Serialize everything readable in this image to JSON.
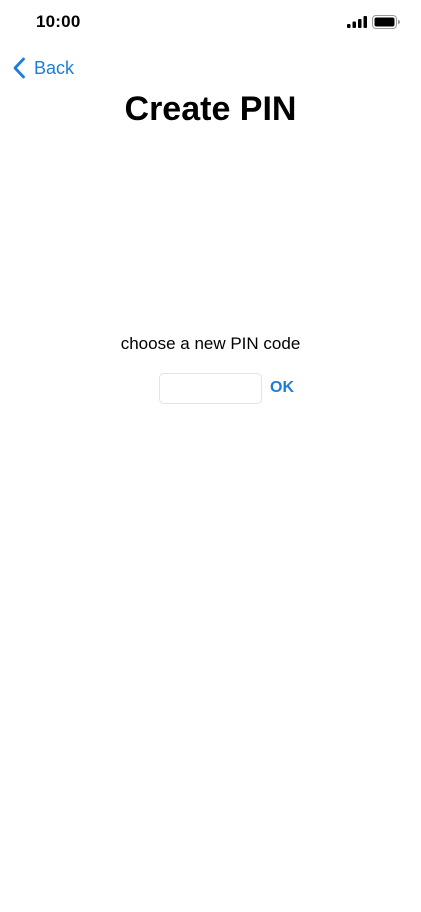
{
  "status_bar": {
    "time": "10:00",
    "signal_icon": "cellular-signal-icon",
    "battery_icon": "battery-icon"
  },
  "nav": {
    "back_label": "Back",
    "back_icon": "chevron-left-icon"
  },
  "page": {
    "title": "Create PIN",
    "prompt": "choose a new PIN code"
  },
  "pin_form": {
    "input_value": "",
    "ok_label": "OK"
  },
  "colors": {
    "accent": "#1a7fd6",
    "text": "#000000",
    "input_border": "#e3e3e3"
  }
}
